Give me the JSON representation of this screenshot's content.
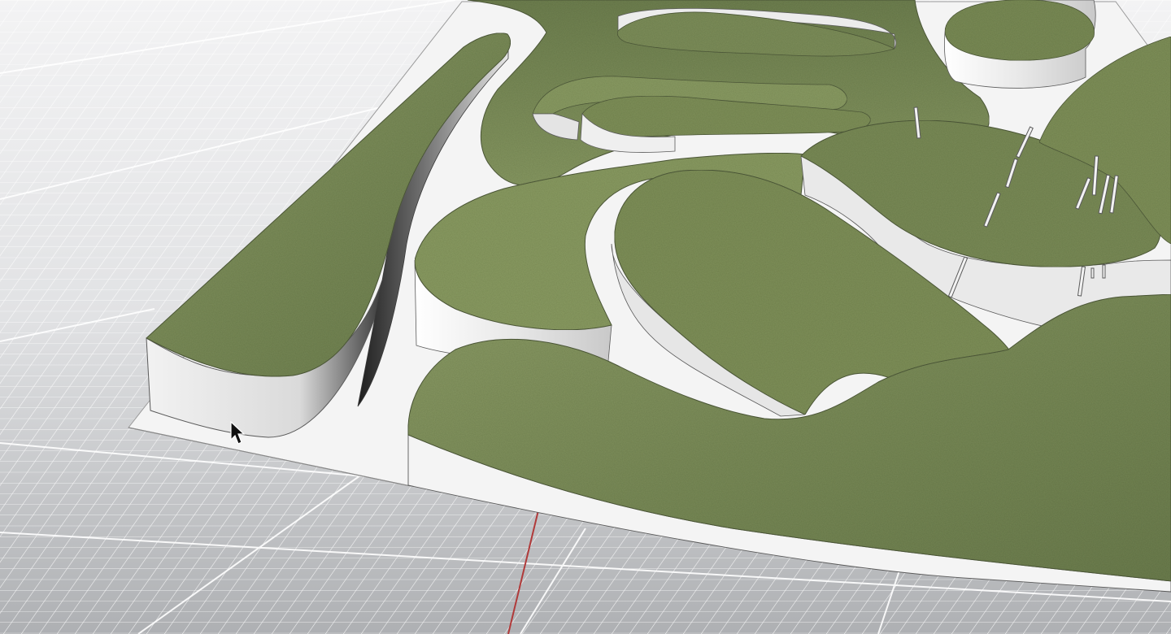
{
  "viewport": {
    "kind": "3d-perspective-viewport",
    "background_color": "#bfc1c4",
    "grid_color": "#ffffff",
    "axis_color": "#b03a3a",
    "base_plate_color": "#f4f4f4",
    "wall_color": "#eeeeee",
    "wall_shadow_color": "#2e2e2e",
    "terrain_colors": [
      "#8a9b63",
      "#728353",
      "#5e6d45"
    ],
    "cursor_icon": "arrow-cursor-icon"
  }
}
